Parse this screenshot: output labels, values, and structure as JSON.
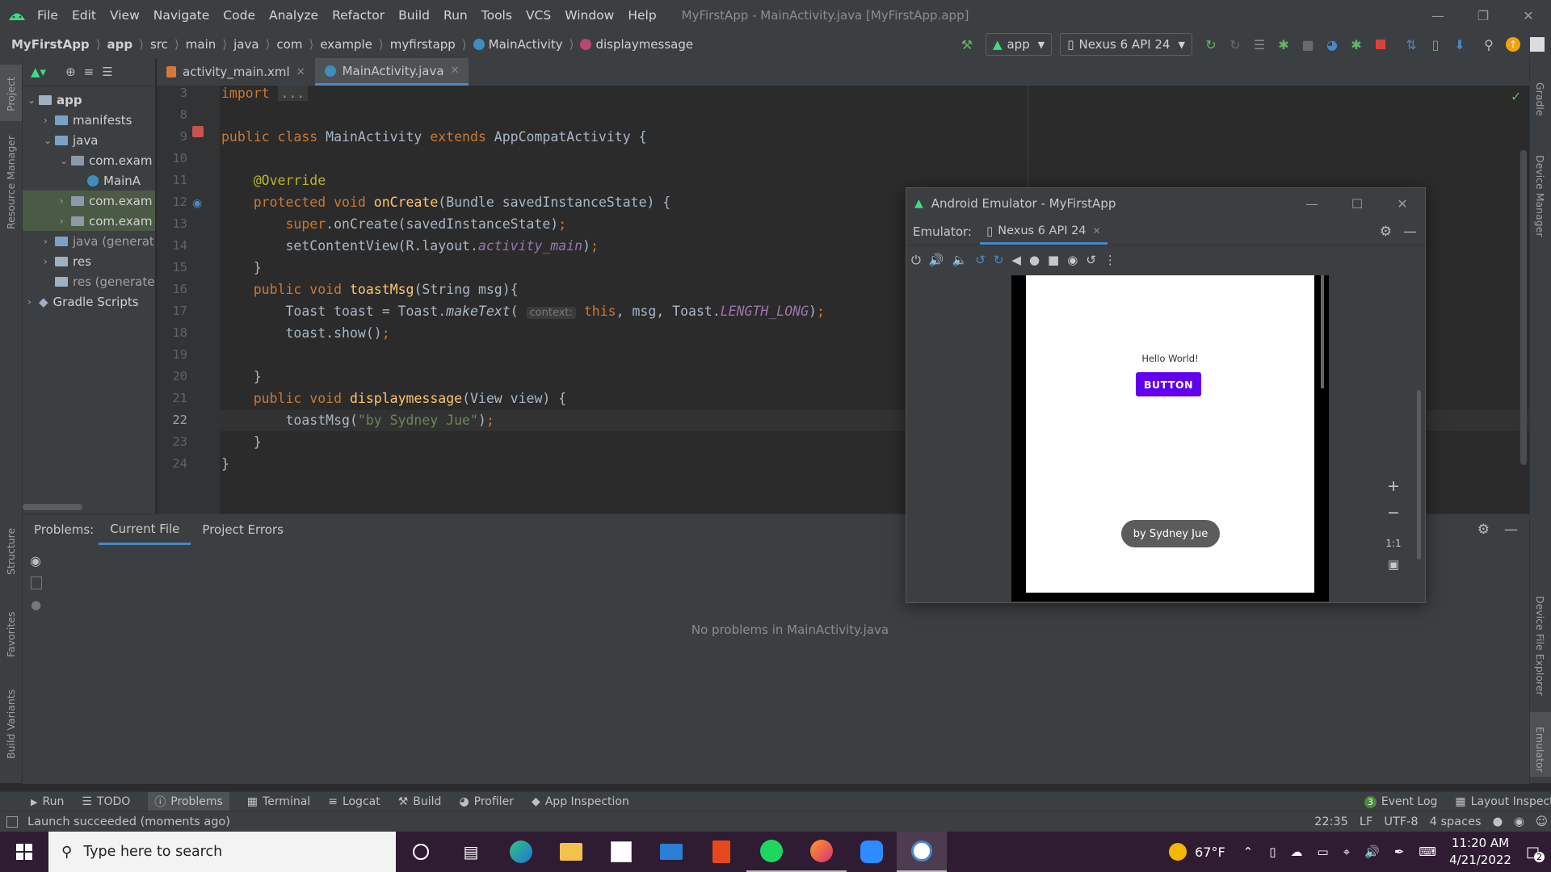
{
  "menubar": {
    "items": [
      "File",
      "Edit",
      "View",
      "Navigate",
      "Code",
      "Analyze",
      "Refactor",
      "Build",
      "Run",
      "Tools",
      "VCS",
      "Window",
      "Help"
    ],
    "title": "MyFirstApp - MainActivity.java [MyFirstApp.app]"
  },
  "breadcrumb": [
    "MyFirstApp",
    "app",
    "src",
    "main",
    "java",
    "com",
    "example",
    "myfirstapp",
    "MainActivity",
    "displaymessage"
  ],
  "toolbar": {
    "run_config": "app",
    "device": "Nexus 6 API 24"
  },
  "left_tools": [
    "Project",
    "Resource Manager",
    "Structure",
    "Favorites",
    "Build Variants"
  ],
  "right_tools": [
    "Gradle",
    "Device Manager",
    "Device File Explorer",
    "Emulator"
  ],
  "project_tree": [
    {
      "label": "app",
      "indent": 0,
      "expanded": true
    },
    {
      "label": "manifests",
      "indent": 1
    },
    {
      "label": "java",
      "indent": 1,
      "expanded": true
    },
    {
      "label": "com.exam",
      "indent": 2,
      "expanded": true
    },
    {
      "label": "MainA",
      "indent": 3
    },
    {
      "label": "com.exam",
      "indent": 2,
      "selected": true
    },
    {
      "label": "com.exam",
      "indent": 2,
      "selected": true
    },
    {
      "label": "java (generat",
      "indent": 1
    },
    {
      "label": "res",
      "indent": 1
    },
    {
      "label": "res (generate",
      "indent": 1
    },
    {
      "label": "Gradle Scripts",
      "indent": 0
    }
  ],
  "editor_tabs": [
    {
      "label": "activity_main.xml",
      "active": false
    },
    {
      "label": "MainActivity.java",
      "active": true
    }
  ],
  "code": {
    "line_numbers": [
      "3",
      "8",
      "9",
      "10",
      "11",
      "12",
      "13",
      "14",
      "15",
      "16",
      "17",
      "18",
      "19",
      "20",
      "21",
      "22",
      "23",
      "24"
    ],
    "hint_context": "context:",
    "s_import": "import",
    "s_ellipsis": "...",
    "s_public": "public",
    "s_class": "class",
    "s_mainactivity": "MainActivity",
    "s_extends": "extends",
    "s_appcompat": "AppCompatActivity {",
    "s_override": "@Override",
    "s_protected": "protected",
    "s_void": "void",
    "s_oncreate": "onCreate",
    "s_bundle": "(Bundle savedInstanceState) {",
    "s_super": "super",
    "s_superrest": ".onCreate(savedInstanceState)",
    "s_semicolon": ";",
    "s_setcontent": "setContentView(R.layout.",
    "s_activitymain": "activity_main",
    "s_close_paren": ")",
    "s_rbrace": "}",
    "s_toastmsg": "toastMsg",
    "s_toastsig": "(String msg){",
    "s_toastdecl": "Toast toast = Toast.",
    "s_maketext": "makeText",
    "s_paren": "(",
    "s_this": "this",
    "s_msgargs": ", msg, Toast.",
    "s_lengthlong": "LENGTH_LONG",
    "s_toastshow": "toast.show()",
    "s_displaymsg": "displaymessage",
    "s_viewsig": "(View view) {",
    "s_toastcall": "toastMsg(",
    "s_string": "\"by Sydney Jue\""
  },
  "problems": {
    "label": "Problems:",
    "tabs": [
      "Current File",
      "Project Errors"
    ],
    "empty_message": "No problems in MainActivity.java"
  },
  "bottom_tools": [
    "Run",
    "TODO",
    "Problems",
    "Terminal",
    "Logcat",
    "Build",
    "Profiler",
    "App Inspection"
  ],
  "bottom_right_tools": [
    "Event Log",
    "Layout Inspector"
  ],
  "event_log_count": "3",
  "status": {
    "message": "Launch succeeded (moments ago)",
    "position": "22:35",
    "line_sep": "LF",
    "encoding": "UTF-8",
    "indent": "4 spaces"
  },
  "emulator": {
    "title": "Android Emulator - MyFirstApp",
    "label": "Emulator:",
    "tab": "Nexus 6 API 24",
    "app_text": "Hello World!",
    "app_button": "BUTTON",
    "toast": "by Sydney Jue",
    "zoom_1_1": "1:1"
  },
  "taskbar": {
    "search_placeholder": "Type here to search",
    "weather": "67°F",
    "time": "11:20 AM",
    "date": "4/21/2022",
    "notifications": "2"
  },
  "colors": {
    "accent": "#4a88c7",
    "android_green": "#3ddc84",
    "app_button": "#6200ee",
    "taskbar": "#2f1c32"
  }
}
